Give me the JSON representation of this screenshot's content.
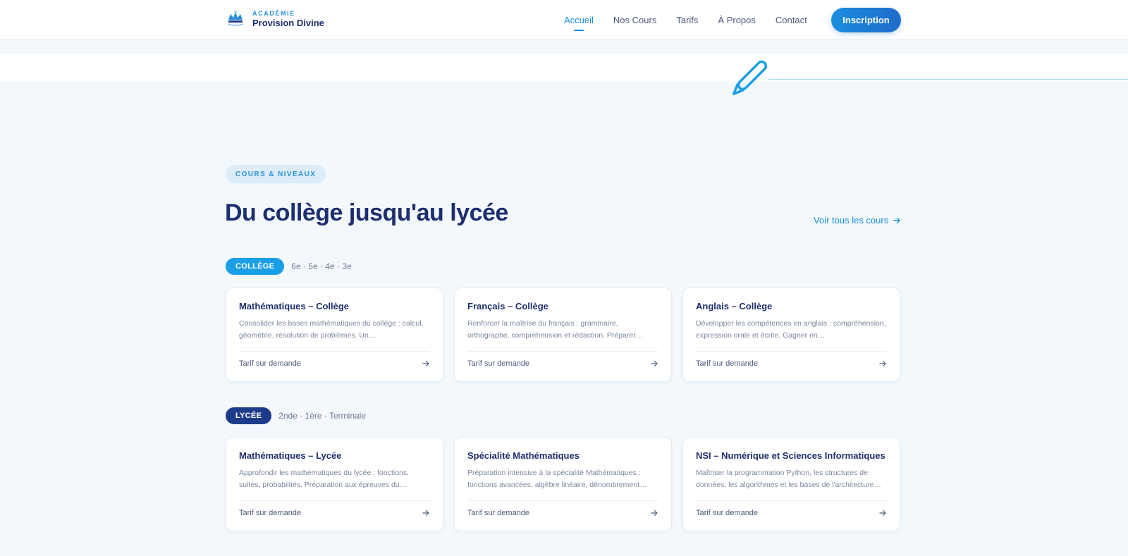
{
  "brand": {
    "subtitle": "ACADÉMIE",
    "name": "Provision Divine"
  },
  "nav": {
    "items": [
      {
        "label": "Accueil",
        "active": true
      },
      {
        "label": "Nos Cours",
        "active": false
      },
      {
        "label": "Tarifs",
        "active": false
      },
      {
        "label": "À Propos",
        "active": false
      },
      {
        "label": "Contact",
        "active": false
      }
    ],
    "cta": "Inscription"
  },
  "section": {
    "eyebrow": "COURS & NIVEAUX",
    "title": "Du collège jusqu'au lycée",
    "see_all": "Voir tous les cours"
  },
  "levels": [
    {
      "label": "COLLÈGE",
      "grades": "6e · 5e · 4e · 3e",
      "courses": [
        {
          "title": "Mathématiques – Collège",
          "desc": "Consolider les bases mathématiques du collège : calcul, géométrie, résolution de problèmes. Un…",
          "price": "Tarif sur demande"
        },
        {
          "title": "Français – Collège",
          "desc": "Renforcer la maîtrise du français : grammaire, orthographe, compréhension et rédaction. Préparer…",
          "price": "Tarif sur demande"
        },
        {
          "title": "Anglais – Collège",
          "desc": "Développer les compétences en anglais : compréhension, expression orale et écrite. Gagner en…",
          "price": "Tarif sur demande"
        }
      ]
    },
    {
      "label": "LYCÉE",
      "grades": "2nde · 1ère · Terminale",
      "courses": [
        {
          "title": "Mathématiques – Lycée",
          "desc": "Approfondir les mathématiques du lycée : fonctions, suites, probabilités. Préparation aux épreuves du…",
          "price": "Tarif sur demande"
        },
        {
          "title": "Spécialité Mathématiques",
          "desc": "Préparation intensive à la spécialité Mathématiques : fonctions avancées, algèbre linéaire, dénombrement…",
          "price": "Tarif sur demande"
        },
        {
          "title": "NSI – Numérique et Sciences Informatiques",
          "desc": "Maîtriser la programmation Python, les structures de données, les algorithmes et les bases de l'architecture…",
          "price": "Tarif sur demande"
        }
      ]
    }
  ],
  "colors": {
    "primary": "#1a8ee0",
    "navy": "#1e2f6e",
    "background": "#f3f8fc"
  }
}
